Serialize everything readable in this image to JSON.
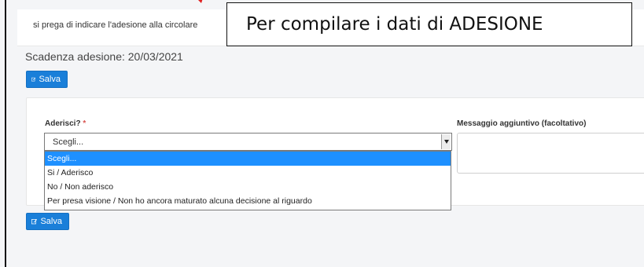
{
  "notice": {
    "text": "si prega di indicare l'adesione alla circolare"
  },
  "callout": {
    "text": "Per compilare i dati di ADESIONE"
  },
  "deadline": {
    "text": "Scadenza adesione: 20/03/2021"
  },
  "buttons": {
    "save_top": "Salva",
    "save_bottom": "Salva"
  },
  "form": {
    "aderisci_label": "Aderisci?",
    "required_mark": "*",
    "message_label": "Messaggio aggiuntivo (facoltativo)",
    "select_value": "Scegli...",
    "options": [
      "Scegli...",
      "Si / Aderisco",
      "No / Non aderisco",
      "Per presa visione / Non ho ancora maturato alcuna decisione al riguardo"
    ],
    "selected_index": 0
  },
  "colors": {
    "primary": "#1a7fd9",
    "highlight": "#1e90ff",
    "required": "#d9534f",
    "annotation_arrow": "#e02020"
  },
  "icons": {
    "save": "edit-icon",
    "select_arrow": "caret-down-icon",
    "annotation": "red-arrow-icon"
  }
}
